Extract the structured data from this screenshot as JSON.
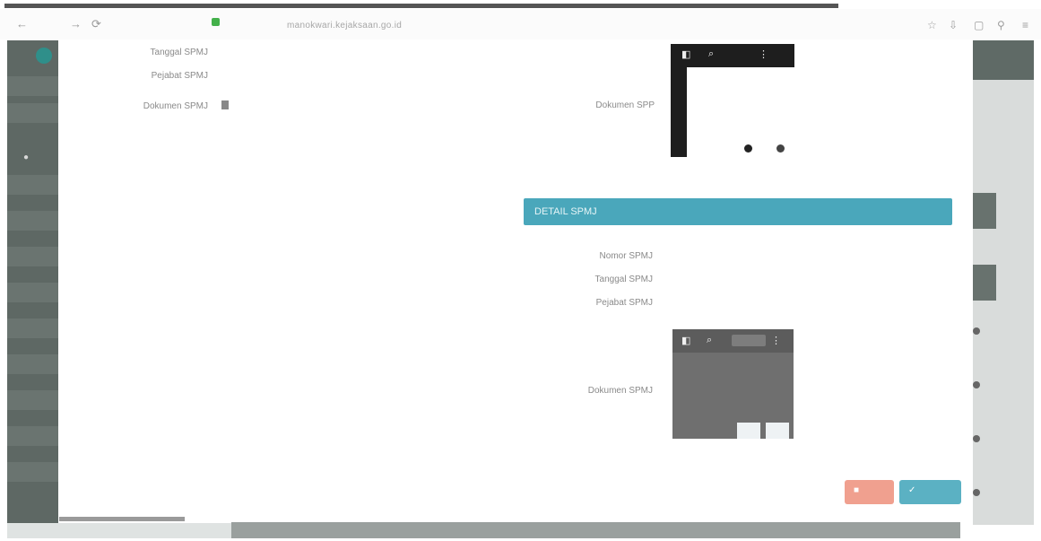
{
  "browser": {
    "back": "←",
    "forward": "→",
    "reload": "⟳",
    "url": "manokwari.kejaksaan.go.id",
    "icons": [
      "bookmark-icon",
      "downloads-icon",
      "tabs-icon",
      "extensions-icon",
      "menu-icon"
    ]
  },
  "left_form": {
    "tanggal_label": "Tanggal SPMJ",
    "pejabat_label": "Pejabat SPMJ",
    "dokumen_label": "Dokumen SPMJ"
  },
  "spp": {
    "label": "Dokumen SPP"
  },
  "detail": {
    "header": "DETAIL SPMJ",
    "nomor_label": "Nomor SPMJ",
    "nomor_value": "",
    "tanggal_label": "Tanggal SPMJ",
    "tanggal_value": "",
    "pejabat_label": "Pejabat SPMJ",
    "pejabat_value": "",
    "dokumen_label": "Dokumen SPMJ"
  },
  "footer": {
    "text": "",
    "link": ""
  }
}
